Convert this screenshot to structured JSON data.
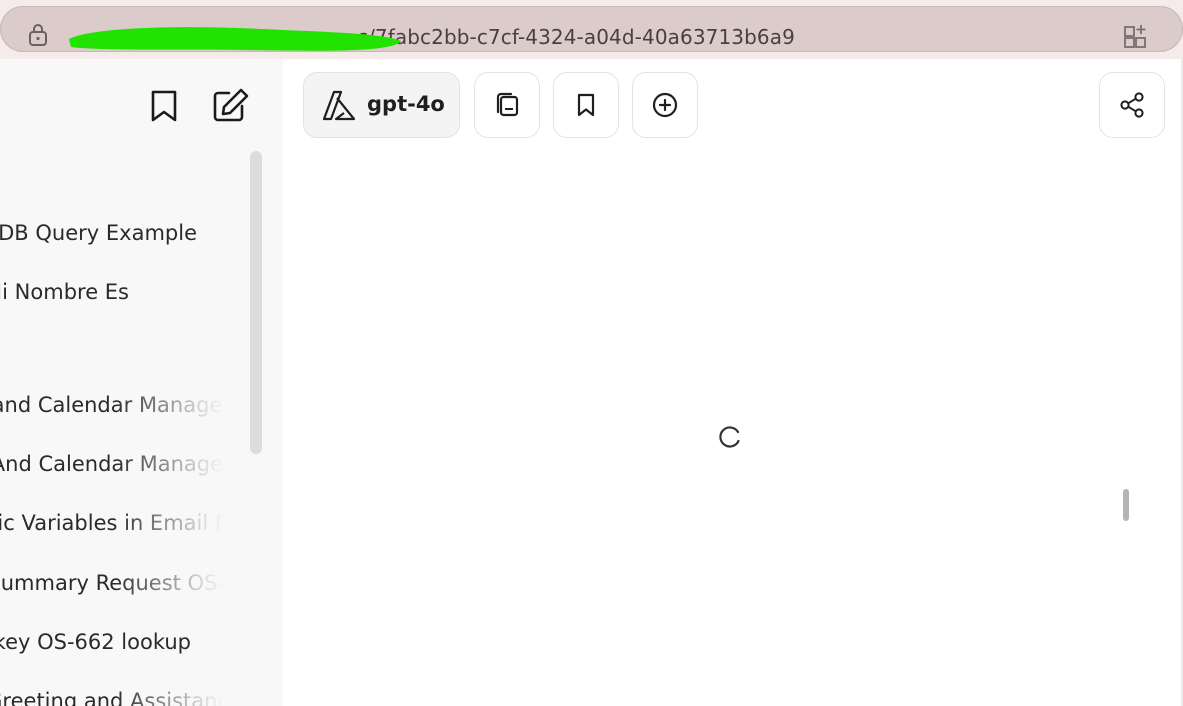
{
  "browser": {
    "url_visible": "c/7fabc2bb-c7cf-4324-a04d-40a63713b6a9"
  },
  "sidebar": {
    "conversations": [
      {
        "label": "goDB Query Example"
      },
      {
        "label": "Mi Nombre Es"
      },
      {
        "label": "and Calendar Manager"
      },
      {
        "label": "And Calendar Manage"
      },
      {
        "label": "nic Variables in Email M"
      },
      {
        "label": "Summary Request OS-"
      },
      {
        "label": "key OS-662 lookup"
      },
      {
        "label": "Greeting and Assistanc"
      }
    ]
  },
  "toolbar": {
    "model_label": "gpt-4o"
  },
  "icons": {
    "lock": "lock-icon",
    "extensions": "extensions-icon",
    "sidebar_bookmark": "bookmark-icon",
    "new_chat": "new-chat-icon",
    "model": "azure-icon",
    "presets": "copy-icon",
    "bookmark": "bookmark-icon",
    "add": "plus-circle-icon",
    "share": "share-icon",
    "loading": "spinner-icon"
  },
  "colors": {
    "redaction": "#22e300",
    "sidebar_bg": "#f8f8f8",
    "browser_bar": "#dccbcb"
  }
}
